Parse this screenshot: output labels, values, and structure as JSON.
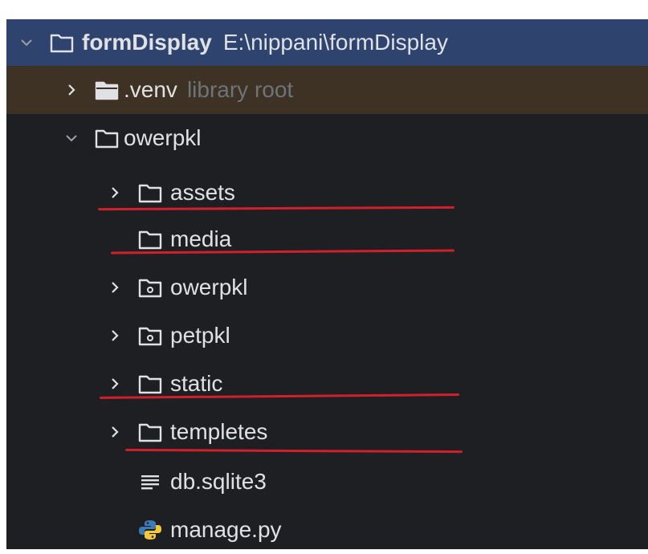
{
  "tree": {
    "root": {
      "name": "formDisplay",
      "path": "E:\\nippani\\formDisplay"
    },
    "venv": {
      "name": ".venv",
      "note": "library root"
    },
    "project": {
      "name": "owerpkl"
    },
    "items": [
      {
        "name": "assets"
      },
      {
        "name": "media"
      },
      {
        "name": "owerpkl"
      },
      {
        "name": "petpkl"
      },
      {
        "name": "static"
      },
      {
        "name": "templetes"
      },
      {
        "name": "db.sqlite3"
      },
      {
        "name": "manage.py"
      }
    ]
  },
  "colors": {
    "background": "#1e1f22",
    "selected_row": "#2e436e",
    "venv_row": "#3d3223",
    "text": "#dfe1e5",
    "muted_text": "#6f737a",
    "annotation_red": "#d11f2b"
  }
}
